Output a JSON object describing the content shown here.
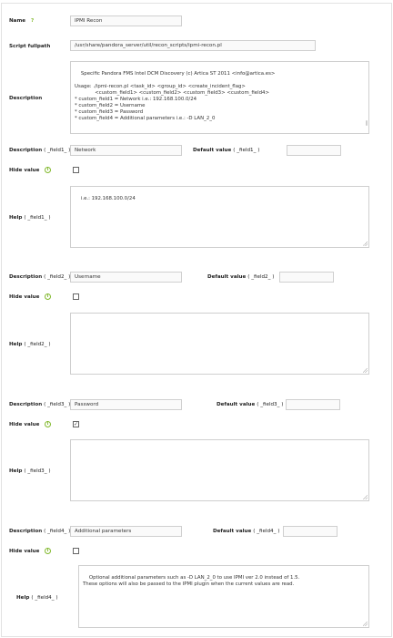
{
  "form": {
    "name": {
      "label": "Name",
      "required_mark": "?",
      "value": "IPMI Recon"
    },
    "script_fullpath": {
      "label": "Script fullpath",
      "value": "/usr/share/pandora_server/util/recon_scripts/ipmi-recon.pl"
    },
    "description": {
      "label": "Description",
      "value": "Specific Pandora FMS Intel DCM Discovery (c) Artica ST 2011 <info@artica.es>\n\nUsage: ./ipmi-recon.pl <task_id> <group_id> <create_incident_flag>\n             <custom_field1> <custom_field2> <custom_field3> <custom_field4>\n* custom_field1 = Network i.e.: 192.168.100.0/24\n* custom_field2 = Username\n* custom_field3 = Password\n* custom_field4 = Additional parameters i.e.: -D LAN_2_0"
    },
    "fields": [
      {
        "desc_label": "Description",
        "desc_suffix": "( _field1_ )",
        "desc_value": "Network",
        "default_label": "Default value",
        "default_suffix": "( _field1_ )",
        "default_value": "",
        "hide_label": "Hide value",
        "hide_checked": false,
        "help_label": "Help",
        "help_suffix": "( _field1_ )",
        "help_value": "i.e.: 192.168.100.0/24"
      },
      {
        "desc_label": "Description",
        "desc_suffix": "( _field2_ )",
        "desc_value": "Username",
        "default_label": "Default value",
        "default_suffix": "( _field2_ )",
        "default_value": "",
        "hide_label": "Hide value",
        "hide_checked": false,
        "help_label": "Help",
        "help_suffix": "( _field2_ )",
        "help_value": ""
      },
      {
        "desc_label": "Description",
        "desc_suffix": "( _field3_ )",
        "desc_value": "Password",
        "default_label": "Default value",
        "default_suffix": "( _field3_ )",
        "default_value": "",
        "hide_label": "Hide value",
        "hide_checked": true,
        "help_label": "Help",
        "help_suffix": "( _field3_ )",
        "help_value": ""
      },
      {
        "desc_label": "Description",
        "desc_suffix": "( _field4_ )",
        "desc_value": "Additional parameters",
        "default_label": "Default value",
        "default_suffix": "( _field4_ )",
        "default_value": "",
        "hide_label": "Hide value",
        "hide_checked": false,
        "help_label": "Help",
        "help_suffix": "( _field4_ )",
        "help_value": "Optional additional parameters such as -D LAN_2_0 to use IPMI ver 2.0 instead of 1.5.\nThese options will also be passed to the IPMI plugin when the current values are read."
      }
    ],
    "info_icon_glyph": "i",
    "check_glyph": "✓"
  },
  "colors": {
    "accent": "#82b92e",
    "border": "#cfcfcf"
  }
}
